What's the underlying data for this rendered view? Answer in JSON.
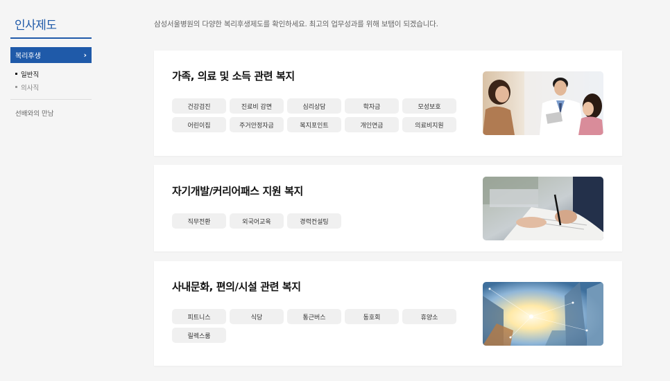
{
  "sidebar": {
    "title": "인사제도",
    "active": {
      "label": "복리후생",
      "chevron": "›"
    },
    "sub_items": [
      {
        "label": "일반직"
      },
      {
        "label": "의사직"
      }
    ],
    "link": "선배와의 만남"
  },
  "intro": "삼성서울병원의 다양한 복리후생제도를 확인하세요. 최고의 업무성과를 위해 보탬이 되겠습니다.",
  "cards": [
    {
      "title": "가족, 의료 및 소득 관련 복지",
      "chips": [
        "건강검진",
        "진료비 감면",
        "심리상담",
        "학자금",
        "모성보호",
        "어린이집",
        "주거안정자금",
        "복지포인트",
        "개인연금",
        "의료비지원"
      ],
      "image": "doctor-family-photo"
    },
    {
      "title": "자기개발/커리어패스 지원 복지",
      "chips": [
        "직무전환",
        "외국어교육",
        "경력컨설팅"
      ],
      "image": "handshake-documents-photo"
    },
    {
      "title": "사내문화, 편의/시설 관련 복지",
      "chips": [
        "피트니스",
        "식당",
        "통근버스",
        "동호회",
        "휴양소",
        "릴렉스룸"
      ],
      "image": "city-skyline-photo"
    }
  ]
}
